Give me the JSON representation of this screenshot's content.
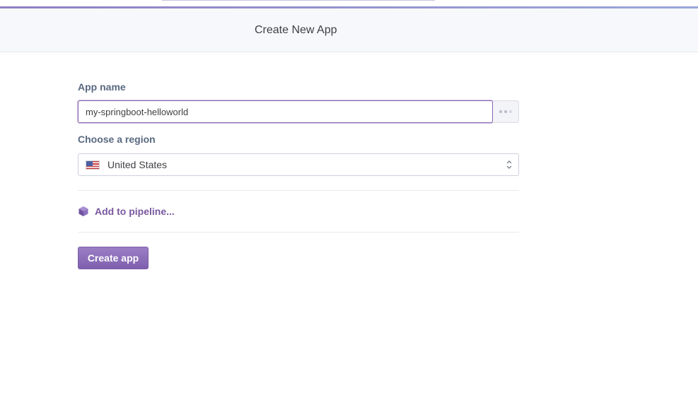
{
  "header": {
    "title": "Create New App"
  },
  "form": {
    "app_name_label": "App name",
    "app_name_value": "my-springboot-helloworld",
    "region_label": "Choose a region",
    "region_value": "United States",
    "region_flag_icon": "us-flag-icon",
    "pipeline_link": "Add to pipeline...",
    "pipeline_icon": "pipeline-hexagon-icon",
    "submit_label": "Create app"
  },
  "colors": {
    "accent": "#79589f",
    "button": "#8a6cb8",
    "label": "#596981",
    "header_bg": "#f7f8fb"
  }
}
